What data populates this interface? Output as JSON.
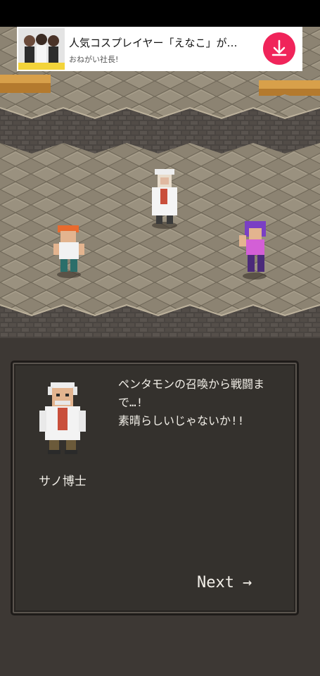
{
  "ad": {
    "title": "人気コスプレイヤー「えなこ」が…",
    "subtitle": "おねがい社長!",
    "download_icon": "download-arrow",
    "accent_color": "#f0245a"
  },
  "dialog": {
    "speaker": "サノ博士",
    "text": "ペンタモンの召喚から戦闘まで…!\n素晴らしいじゃないか!!",
    "next_label": "Next",
    "next_arrow": "→"
  }
}
